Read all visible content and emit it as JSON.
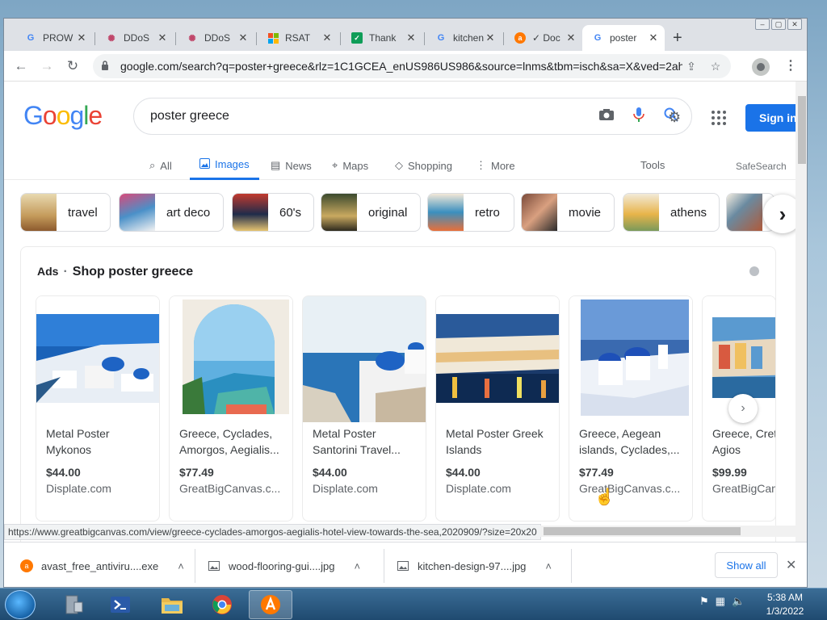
{
  "browser": {
    "tabs": [
      {
        "title": "PROW",
        "icon": "google-icon"
      },
      {
        "title": "DDoS",
        "icon": "gear-favicon-icon"
      },
      {
        "title": "DDoS",
        "icon": "gear-favicon-icon"
      },
      {
        "title": "RSAT",
        "icon": "microsoft-icon"
      },
      {
        "title": "Thank",
        "icon": "sheets-icon"
      },
      {
        "title": "kitchen",
        "icon": "google-icon"
      },
      {
        "title": "✓ Doc",
        "icon": "avast-icon"
      },
      {
        "title": "poster",
        "icon": "google-icon"
      }
    ],
    "url": "google.com/search?q=poster+greece&rlz=1C1GCEA_enUS986US986&source=lnms&tbm=isch&sa=X&ved=2ah..."
  },
  "google": {
    "logo": "Google",
    "query": "poster greece",
    "signin": "Sign in",
    "nav": [
      {
        "label": "All",
        "icon": "search-icon"
      },
      {
        "label": "Images",
        "icon": "image-icon"
      },
      {
        "label": "News",
        "icon": "news-icon"
      },
      {
        "label": "Maps",
        "icon": "map-pin-icon"
      },
      {
        "label": "Shopping",
        "icon": "tag-icon"
      },
      {
        "label": "More",
        "icon": "more-vert-icon"
      }
    ],
    "tools": "Tools",
    "safesearch": "SafeSearch",
    "chips": [
      "travel",
      "art deco",
      "60's",
      "original",
      "retro",
      "movie",
      "athens"
    ],
    "ads_label": "Ads",
    "ads_title": "Shop poster greece",
    "products": [
      {
        "name": "Metal Poster Mykonos",
        "price": "$44.00",
        "store": "Displate.com"
      },
      {
        "name": "Greece, Cyclades, Amorgos, Aegialis...",
        "price": "$77.49",
        "store": "GreatBigCanvas.c..."
      },
      {
        "name": "Metal Poster Santorini Travel...",
        "price": "$44.00",
        "store": "Displate.com"
      },
      {
        "name": "Metal Poster Greek Islands",
        "price": "$44.00",
        "store": "Displate.com"
      },
      {
        "name": "Greece, Aegean islands, Cyclades,...",
        "price": "$77.49",
        "store": "GreatBigCanvas.c..."
      },
      {
        "name": "Greece, Crete Island, Agios",
        "price": "$99.99",
        "store": "GreatBigCan"
      }
    ]
  },
  "status_url": "https://www.greatbigcanvas.com/view/greece-cyclades-amorgos-aegialis-hotel-view-towards-the-sea,2020909/?size=20x20",
  "downloads": [
    {
      "name": "avast_free_antiviru....exe",
      "icon": "avast-icon"
    },
    {
      "name": "wood-flooring-gui....jpg",
      "icon": "image-file-icon"
    },
    {
      "name": "kitchen-design-97....jpg",
      "icon": "image-file-icon"
    }
  ],
  "show_all": "Show all",
  "clock": {
    "time": "5:38 AM",
    "date": "1/3/2022"
  },
  "colors": {
    "accent": "#1a73e8",
    "tabbar": "#dee1e6",
    "taskbar": "#1f4a70"
  }
}
